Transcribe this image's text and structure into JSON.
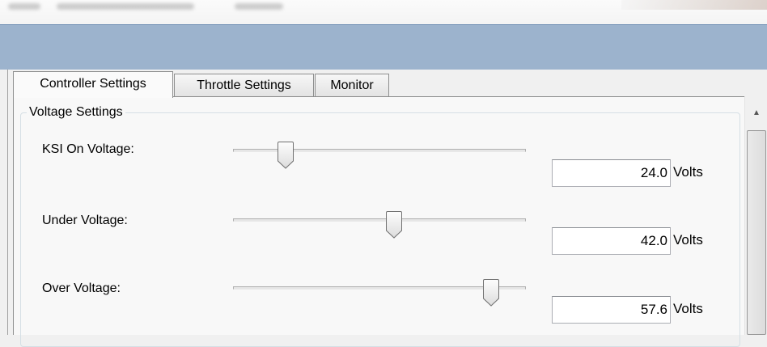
{
  "tabs": [
    {
      "label": "Controller Settings",
      "active": true
    },
    {
      "label": "Throttle Settings",
      "active": false
    },
    {
      "label": "Monitor",
      "active": false
    }
  ],
  "group": {
    "title": "Voltage Settings"
  },
  "settings": [
    {
      "label": "KSI On Voltage:",
      "value": "24.0",
      "unit": "Volts",
      "slider_fraction": 0.18
    },
    {
      "label": "Under Voltage:",
      "value": "42.0",
      "unit": "Volts",
      "slider_fraction": 0.55
    },
    {
      "label": "Over Voltage:",
      "value": "57.6",
      "unit": "Volts",
      "slider_fraction": 0.88
    }
  ],
  "colors": {
    "titlebar": "#9cb3cd",
    "panel": "#f8f8f8",
    "window": "#f0f0f0"
  },
  "icons": {
    "scroll_up": "scroll-up-arrow-icon"
  }
}
